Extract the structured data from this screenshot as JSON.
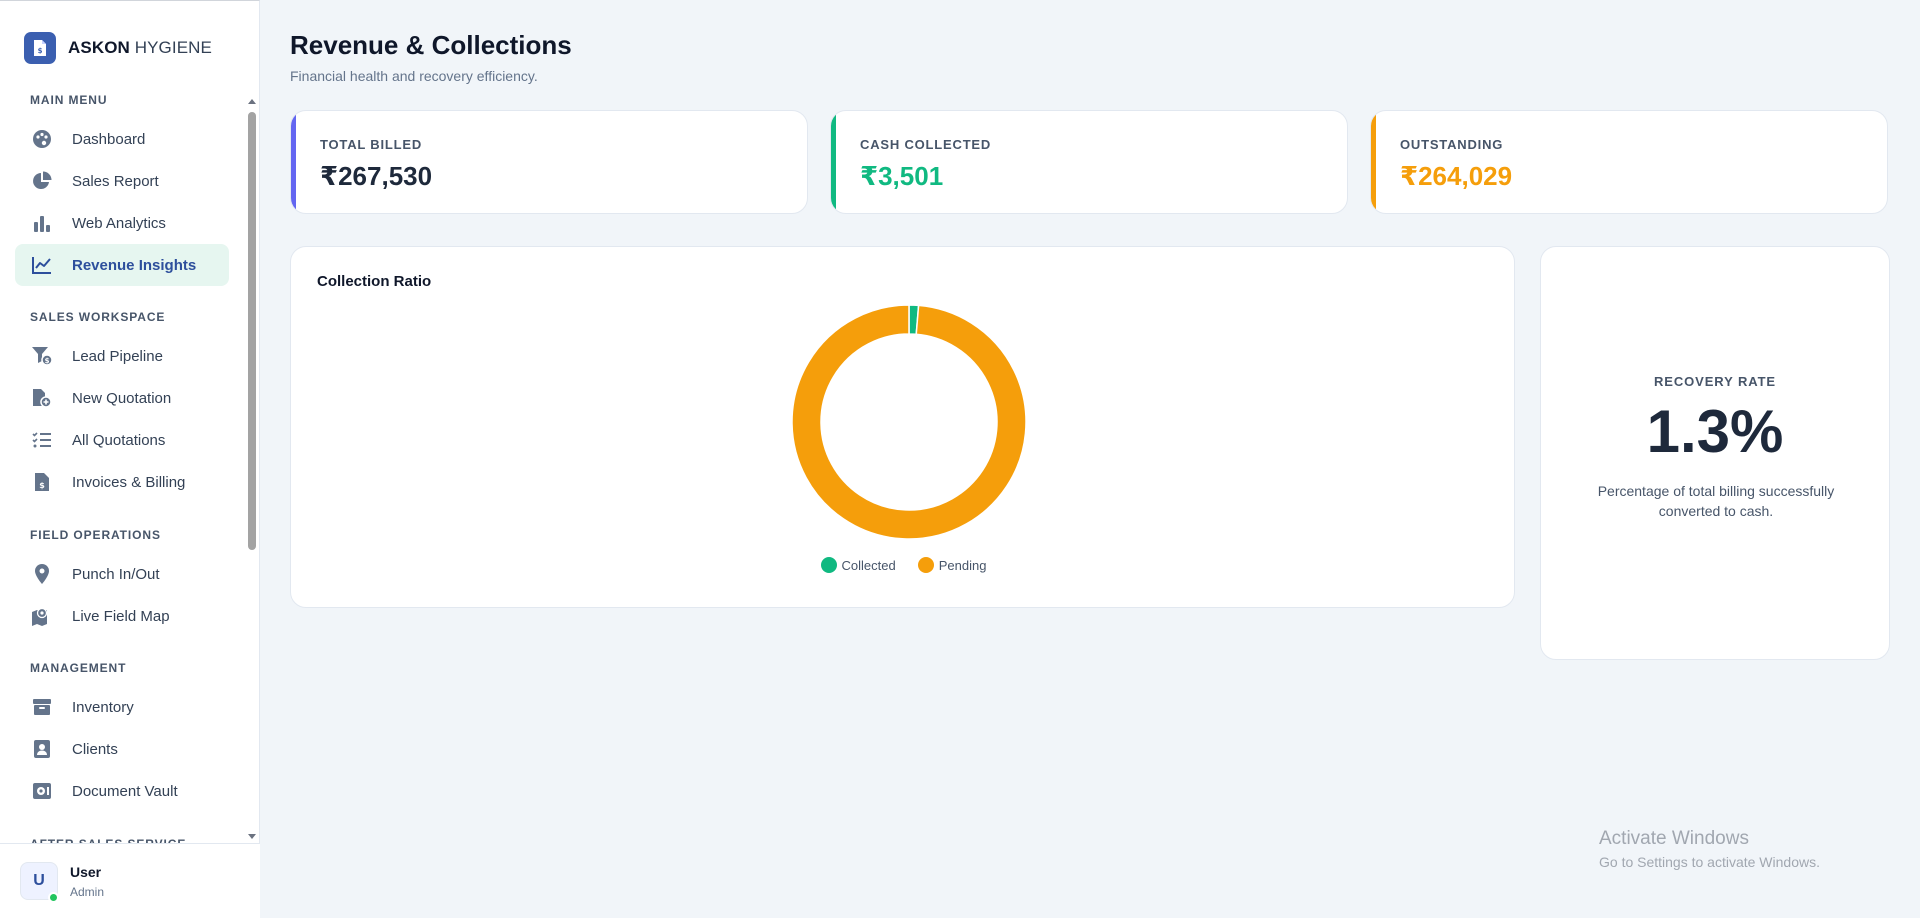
{
  "brand": {
    "name_bold": "ASKON",
    "name_rest": "HYGIENE",
    "logo_icon": "invoice-icon"
  },
  "sidebar": {
    "sections": [
      {
        "title": "MAIN MENU",
        "items": [
          {
            "label": "Dashboard",
            "icon": "palette-icon"
          },
          {
            "label": "Sales Report",
            "icon": "pie-chart-icon"
          },
          {
            "label": "Web Analytics",
            "icon": "bar-chart-icon"
          },
          {
            "label": "Revenue Insights",
            "icon": "line-chart-icon",
            "active": true
          }
        ]
      },
      {
        "title": "SALES WORKSPACE",
        "items": [
          {
            "label": "Lead Pipeline",
            "icon": "funnel-dollar-icon"
          },
          {
            "label": "New Quotation",
            "icon": "file-add-icon"
          },
          {
            "label": "All Quotations",
            "icon": "list-check-icon"
          },
          {
            "label": "Invoices & Billing",
            "icon": "invoice-dollar-icon"
          }
        ]
      },
      {
        "title": "FIELD OPERATIONS",
        "items": [
          {
            "label": "Punch In/Out",
            "icon": "map-pin-icon"
          },
          {
            "label": "Live Field Map",
            "icon": "map-location-icon"
          }
        ]
      },
      {
        "title": "MANAGEMENT",
        "items": [
          {
            "label": "Inventory",
            "icon": "archive-box-icon"
          },
          {
            "label": "Clients",
            "icon": "contact-card-icon"
          },
          {
            "label": "Document Vault",
            "icon": "vault-icon"
          }
        ]
      },
      {
        "title": "AFTER SALES SERVICE",
        "items": []
      }
    ]
  },
  "user": {
    "initial": "U",
    "name": "User",
    "role": "Admin"
  },
  "header": {
    "title": "Revenue & Collections",
    "subtitle": "Financial health and recovery efficiency."
  },
  "stats": [
    {
      "label": "TOTAL BILLED",
      "value": "₹267,530",
      "accent": "#6366f1",
      "color": "#1e293b"
    },
    {
      "label": "CASH COLLECTED",
      "value": "₹3,501",
      "accent": "#10b981",
      "color": "#10b981"
    },
    {
      "label": "OUTSTANDING",
      "value": "₹264,029",
      "accent": "#f59e0b",
      "color": "#f59e0b"
    }
  ],
  "chart_data": {
    "type": "pie",
    "title": "Collection Ratio",
    "categories": [
      "Collected",
      "Pending"
    ],
    "values": [
      3501,
      264029
    ],
    "colors": [
      "#10b981",
      "#f59e0b"
    ],
    "donut": true,
    "legend": "bottom"
  },
  "recovery": {
    "label": "RECOVERY RATE",
    "value": "1.3%",
    "description": "Percentage of total billing successfully converted to cash."
  },
  "watermark": {
    "title": "Activate Windows",
    "subtitle": "Go to Settings to activate Windows."
  }
}
